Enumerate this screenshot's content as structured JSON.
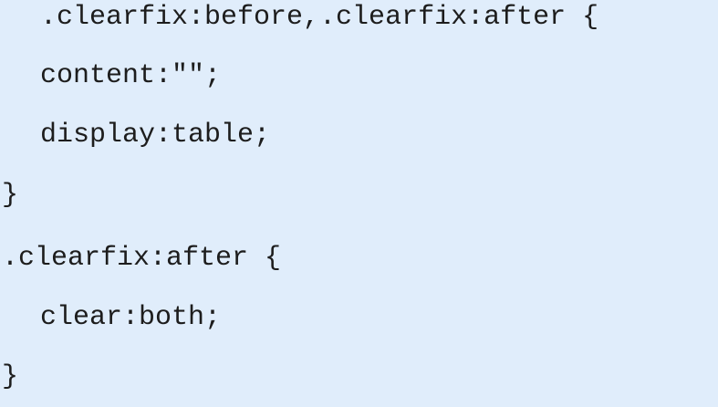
{
  "code": {
    "lines": [
      " .clearfix:before,.clearfix:after {",
      "content:\"\";",
      "display:table;",
      "}",
      ".clearfix:after {",
      "clear:both;",
      "}"
    ]
  },
  "colors": {
    "background": "#e0edfb",
    "text": "#1d1d1d"
  }
}
